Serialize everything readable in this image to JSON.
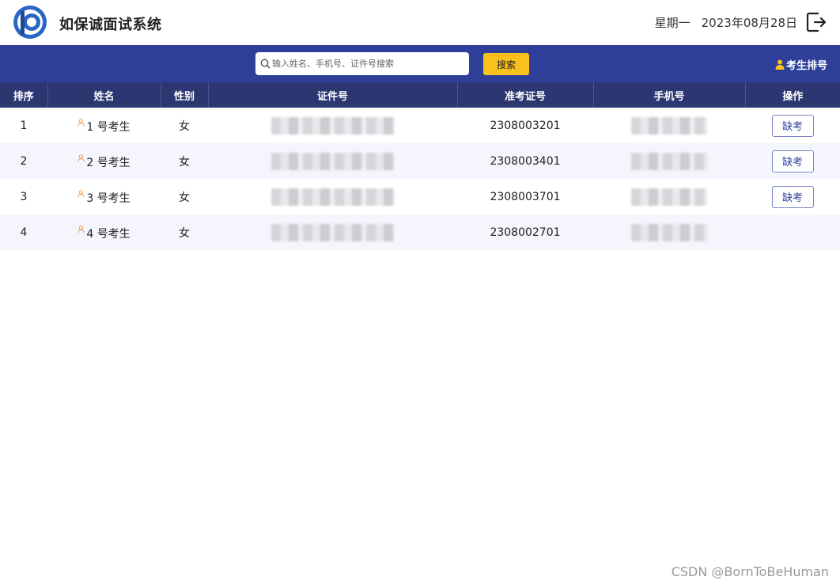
{
  "header": {
    "app_title": "如保诚面试系统",
    "weekday": "星期一",
    "date": "2023年08月28日",
    "logo_icon": "app-logo-icon",
    "exit_icon": "logout-icon"
  },
  "toolbar": {
    "search_placeholder": "输入姓名、手机号、证件号搜索",
    "search_value": "",
    "search_button": "搜索",
    "rank_link": "考生排号",
    "accent": "#2e3f99",
    "button_color": "#f8c11c"
  },
  "table": {
    "columns": [
      "排序",
      "姓名",
      "性别",
      "证件号",
      "准考证号",
      "手机号",
      "操作"
    ],
    "rows": [
      {
        "order": "1",
        "name": "1 号考生",
        "gender": "女",
        "exam_id": "2308003201",
        "action": "缺考"
      },
      {
        "order": "2",
        "name": "2 号考生",
        "gender": "女",
        "exam_id": "2308003401",
        "action": "缺考"
      },
      {
        "order": "3",
        "name": "3 号考生",
        "gender": "女",
        "exam_id": "2308003701",
        "action": "缺考"
      },
      {
        "order": "4",
        "name": "4 号考生",
        "gender": "女",
        "exam_id": "2308002701",
        "action": ""
      }
    ]
  },
  "watermark": "CSDN @BornToBeHuman"
}
